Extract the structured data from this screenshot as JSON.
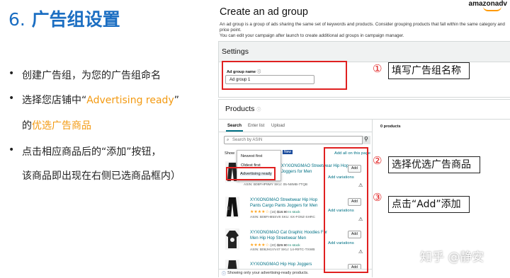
{
  "slide": {
    "number": "6.",
    "title": "广告组设置",
    "bullets": [
      {
        "text": "创建广告组，为您的广告组命名"
      },
      {
        "pre": "选择您店铺中“",
        "hl": "Advertising ready",
        "post": "”"
      },
      {
        "pre": "的",
        "hl": "优选广告商品",
        "post": ""
      },
      {
        "text": "点击相应商品后的“添加”按钮，"
      },
      {
        "text": "该商品即出现在右侧已选商品框内）"
      }
    ]
  },
  "app": {
    "logo": "amazonadv",
    "heading": "Create an ad group",
    "description_1": "An ad group is a group of ads sharing the same set of keywords and products. Consider grouping products that fall within the same category and price point.",
    "description_2": "You can edit your campaign after launch to create additional ad groups in campaign manager.",
    "settings": {
      "title": "Settings",
      "ad_group_name_label": "Ad group name",
      "ad_group_name_value": "Ad group 1"
    },
    "products": {
      "title": "Products",
      "tabs": [
        "Search",
        "Enter list",
        "Upload"
      ],
      "search_placeholder": "Search by ASIN",
      "sort_label": "Show",
      "sort_options": [
        "Newest first",
        "Oldest first",
        "Advertising ready"
      ],
      "new_badge": "New",
      "add_all_label": "Add all on this page",
      "selected_count": "0 products",
      "items": [
        {
          "title_1": "XYXIONGMAO Streetwear Hip Hop",
          "title_2": "Joggers for Men",
          "meta": "ASIN: B08FHP9MY  SKU: 05-N8MB-7TQB",
          "add_label": "Add",
          "variations_label": "Add variations"
        },
        {
          "title_1": "XYXIONGMAO Streetwear Hip Hop",
          "title_2": "Pants Cargo Pants Joggers for Men",
          "price": "$18.90",
          "ratings": "(16)",
          "stock": "In stock",
          "meta": "ASIN: B08FH85SV8  SKU: 6X-FO9Z-SHRC",
          "add_label": "Add",
          "variations_label": "Add variations"
        },
        {
          "title_1": "XYXIONGMAO Cat Graphic Hoodies For",
          "title_2": "Men Hip Hop Streetwear Men",
          "price": "$29.90",
          "ratings": "(20)",
          "stock": "In stock",
          "meta": "ASIN: B08JH1VV47  SKU: 14-R9TC-TXWB",
          "add_label": "Add",
          "variations_label": "Add variations"
        },
        {
          "title_1": "XYXIONGMAO Hip Hop Joggers",
          "add_label": "Add"
        }
      ],
      "footer_note": "Showing only your advertising-ready products."
    }
  },
  "callouts": {
    "c1_num": "①",
    "c1_text": "填写广告组名称",
    "c2_num": "②",
    "c2_text": "选择优选广告商品",
    "c3_num": "③",
    "c3_text": "点击“Add”添加"
  },
  "watermark": "知乎 @静安",
  "colors": {
    "title_blue": "#1b6ec2",
    "highlight_orange": "#f39a12",
    "annotation_red": "#e02020",
    "link_teal": "#007185"
  }
}
